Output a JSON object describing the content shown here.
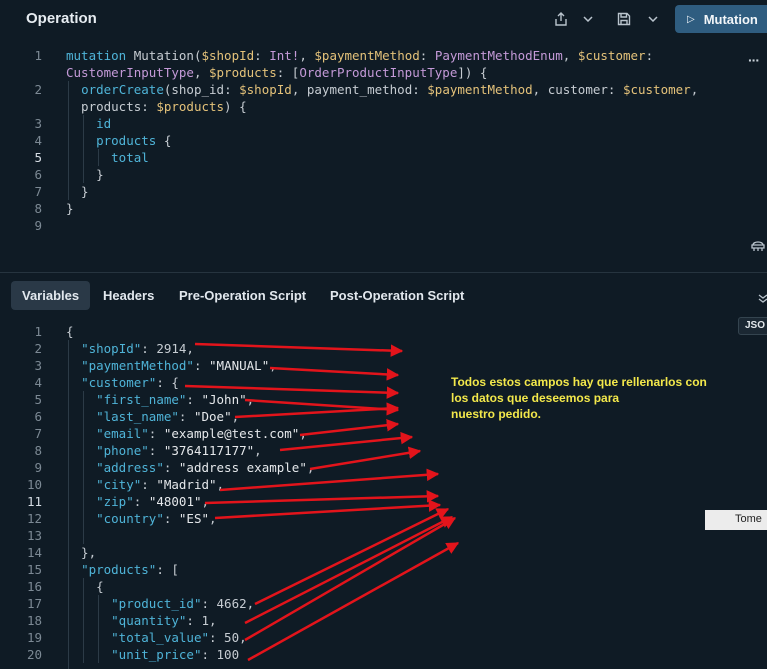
{
  "header": {
    "title": "Operation",
    "run_label": "Mutation"
  },
  "operation_lines": [
    {
      "n": "1",
      "tokens": [
        [
          "k",
          "mutation"
        ],
        [
          "p",
          " Mutation("
        ],
        [
          "v",
          "$shopId"
        ],
        [
          "p",
          ": "
        ],
        [
          "t",
          "Int!"
        ],
        [
          "p",
          ", "
        ],
        [
          "v",
          "$paymentMethod"
        ],
        [
          "p",
          ": "
        ],
        [
          "t",
          "PaymentMethodEnum"
        ],
        [
          "p",
          ", "
        ],
        [
          "v",
          "$customer"
        ],
        [
          "p",
          ":"
        ]
      ]
    },
    {
      "n": "",
      "tokens": [
        [
          "t",
          "CustomerInputType"
        ],
        [
          "p",
          ", "
        ],
        [
          "v",
          "$products"
        ],
        [
          "p",
          ": ["
        ],
        [
          "t",
          "OrderProductInputType"
        ],
        [
          "p",
          "]) {"
        ]
      ]
    },
    {
      "n": "2",
      "tokens": [
        [
          "p",
          "  "
        ],
        [
          "k",
          "orderCreate"
        ],
        [
          "p",
          "(shop_id: "
        ],
        [
          "v",
          "$shopId"
        ],
        [
          "p",
          ", payment_method: "
        ],
        [
          "v",
          "$paymentMethod"
        ],
        [
          "p",
          ", customer: "
        ],
        [
          "v",
          "$customer"
        ],
        [
          "p",
          ","
        ]
      ]
    },
    {
      "n": "",
      "tokens": [
        [
          "p",
          "  products: "
        ],
        [
          "v",
          "$products"
        ],
        [
          "p",
          ") {"
        ]
      ]
    },
    {
      "n": "3",
      "tokens": [
        [
          "p",
          "    "
        ],
        [
          "k",
          "id"
        ]
      ]
    },
    {
      "n": "4",
      "tokens": [
        [
          "p",
          "    "
        ],
        [
          "k",
          "products"
        ],
        [
          "p",
          " {"
        ]
      ]
    },
    {
      "n": "5",
      "tokens": [
        [
          "p",
          "      "
        ],
        [
          "k",
          "total"
        ]
      ]
    },
    {
      "n": "6",
      "tokens": [
        [
          "p",
          "    }"
        ]
      ]
    },
    {
      "n": "7",
      "tokens": [
        [
          "p",
          "  }"
        ]
      ]
    },
    {
      "n": "8",
      "tokens": [
        [
          "p",
          "}"
        ]
      ]
    },
    {
      "n": "9",
      "tokens": []
    }
  ],
  "tabs": [
    "Variables",
    "Headers",
    "Pre-Operation Script",
    "Post-Operation Script"
  ],
  "variables_lines": [
    {
      "n": "1",
      "tokens": [
        [
          "p",
          "{"
        ]
      ]
    },
    {
      "n": "2",
      "tokens": [
        [
          "p",
          "  "
        ],
        [
          "k",
          "\"shopId\""
        ],
        [
          "p",
          ": 2914,"
        ]
      ]
    },
    {
      "n": "3",
      "tokens": [
        [
          "p",
          "  "
        ],
        [
          "k",
          "\"paymentMethod\""
        ],
        [
          "p",
          ": "
        ],
        [
          "s",
          "\"MANUAL\""
        ],
        [
          "p",
          ","
        ]
      ]
    },
    {
      "n": "4",
      "tokens": [
        [
          "p",
          "  "
        ],
        [
          "k",
          "\"customer\""
        ],
        [
          "p",
          ": {"
        ]
      ]
    },
    {
      "n": "5",
      "tokens": [
        [
          "p",
          "    "
        ],
        [
          "k",
          "\"first_name\""
        ],
        [
          "p",
          ": "
        ],
        [
          "s",
          "\"John\""
        ],
        [
          "p",
          ","
        ]
      ]
    },
    {
      "n": "6",
      "tokens": [
        [
          "p",
          "    "
        ],
        [
          "k",
          "\"last_name\""
        ],
        [
          "p",
          ": "
        ],
        [
          "s",
          "\"Doe\""
        ],
        [
          "p",
          ","
        ]
      ]
    },
    {
      "n": "7",
      "tokens": [
        [
          "p",
          "    "
        ],
        [
          "k",
          "\"email\""
        ],
        [
          "p",
          ": "
        ],
        [
          "s",
          "\"example@test.com\""
        ],
        [
          "p",
          ","
        ]
      ]
    },
    {
      "n": "8",
      "tokens": [
        [
          "p",
          "    "
        ],
        [
          "k",
          "\"phone\""
        ],
        [
          "p",
          ": "
        ],
        [
          "s",
          "\"3764117177\""
        ],
        [
          "p",
          ","
        ]
      ]
    },
    {
      "n": "9",
      "tokens": [
        [
          "p",
          "    "
        ],
        [
          "k",
          "\"address\""
        ],
        [
          "p",
          ": "
        ],
        [
          "s",
          "\"address example\""
        ],
        [
          "p",
          ","
        ]
      ]
    },
    {
      "n": "10",
      "tokens": [
        [
          "p",
          "    "
        ],
        [
          "k",
          "\"city\""
        ],
        [
          "p",
          ": "
        ],
        [
          "s",
          "\"Madrid\""
        ],
        [
          "p",
          ","
        ]
      ]
    },
    {
      "n": "11",
      "tokens": [
        [
          "p",
          "    "
        ],
        [
          "k",
          "\"zip\""
        ],
        [
          "p",
          ": "
        ],
        [
          "s",
          "\"48001\""
        ],
        [
          "p",
          ","
        ]
      ]
    },
    {
      "n": "12",
      "tokens": [
        [
          "p",
          "    "
        ],
        [
          "k",
          "\"country\""
        ],
        [
          "p",
          ": "
        ],
        [
          "s",
          "\"ES\""
        ],
        [
          "p",
          ","
        ]
      ]
    },
    {
      "n": "13",
      "tokens": []
    },
    {
      "n": "14",
      "tokens": [
        [
          "p",
          "  },"
        ]
      ]
    },
    {
      "n": "15",
      "tokens": [
        [
          "p",
          "  "
        ],
        [
          "k",
          "\"products\""
        ],
        [
          "p",
          ": ["
        ]
      ]
    },
    {
      "n": "16",
      "tokens": [
        [
          "p",
          "    {"
        ]
      ]
    },
    {
      "n": "17",
      "tokens": [
        [
          "p",
          "      "
        ],
        [
          "k",
          "\"product_id\""
        ],
        [
          "p",
          ": 4662,"
        ]
      ]
    },
    {
      "n": "18",
      "tokens": [
        [
          "p",
          "      "
        ],
        [
          "k",
          "\"quantity\""
        ],
        [
          "p",
          ": 1,"
        ]
      ]
    },
    {
      "n": "19",
      "tokens": [
        [
          "p",
          "      "
        ],
        [
          "k",
          "\"total_value\""
        ],
        [
          "p",
          ": 50,"
        ]
      ]
    },
    {
      "n": "20",
      "tokens": [
        [
          "p",
          "      "
        ],
        [
          "k",
          "\"unit_price\""
        ],
        [
          "p",
          ": 100"
        ]
      ]
    }
  ],
  "json_badge": "JSO",
  "tooltip": "Tome",
  "annotation": [
    "Todos estos campos hay que rellenarlos con",
    "los datos que deseemos para",
    "nuestro pedido."
  ],
  "icons": {
    "share": "share-icon",
    "save": "save-icon",
    "chevron": "chevron-down-icon",
    "play": "play-icon",
    "more": "more-icon",
    "prettify": "prettify-icon",
    "collapse": "chevron-down-icon"
  },
  "colors": {
    "background": "#0f1b25",
    "run_button": "#2f5d80",
    "keyword": "#4fb4d8",
    "variable": "#e4c27a",
    "type": "#c49ad8",
    "annotation": "#f3e84b",
    "arrow": "#e3141b"
  }
}
